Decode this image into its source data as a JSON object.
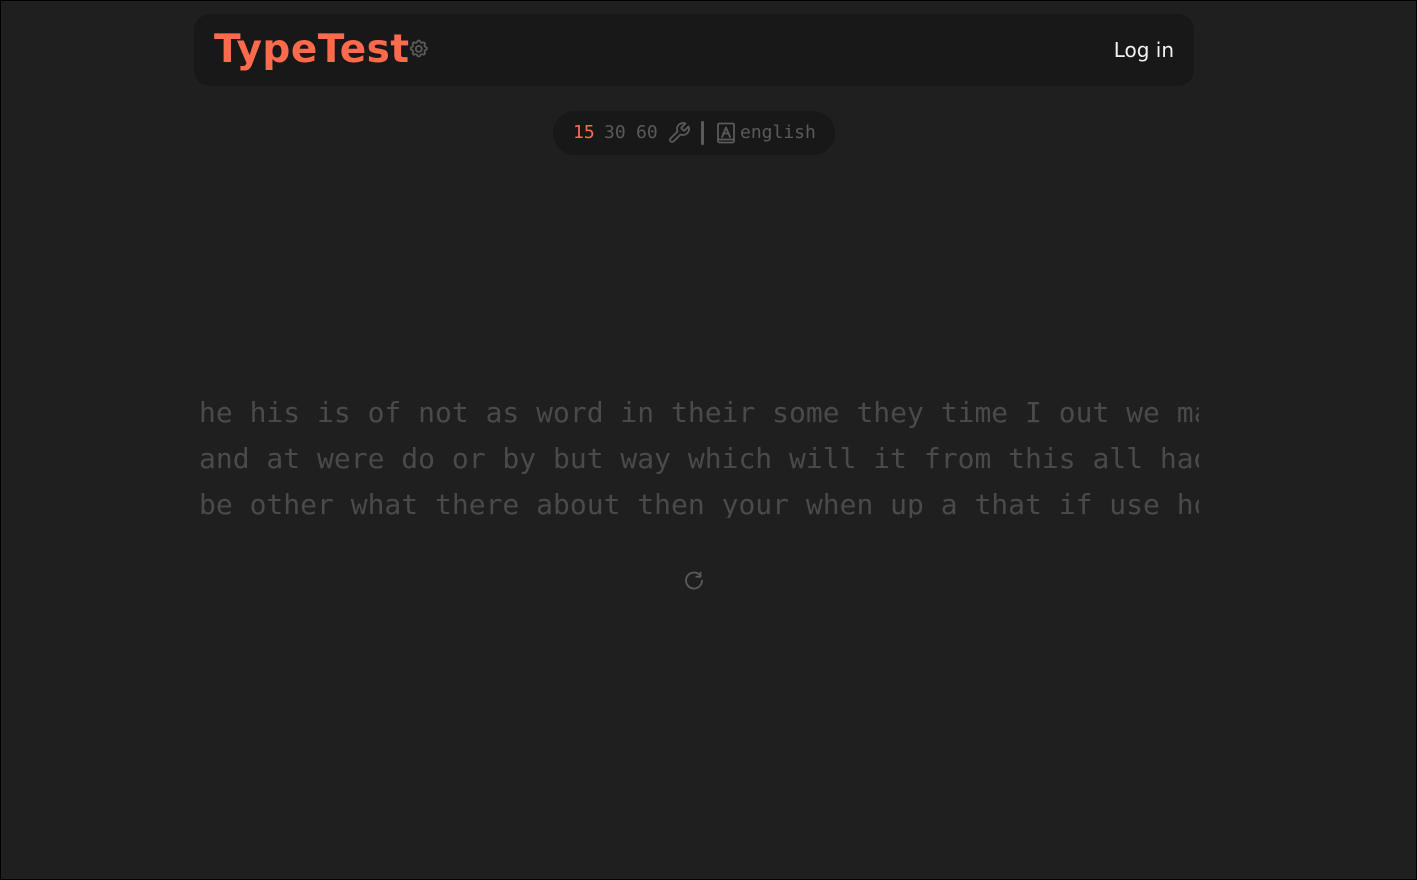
{
  "header": {
    "logo": "TypeTest",
    "settings_icon": "gear-icon",
    "login_label": "Log in"
  },
  "config": {
    "durations": [
      {
        "label": "15",
        "active": true
      },
      {
        "label": "30",
        "active": false
      },
      {
        "label": "60",
        "active": false
      }
    ],
    "custom_icon": "wrench-icon",
    "language_icon": "language-book-icon",
    "language": "english"
  },
  "test": {
    "lines": [
      "he his is of not as word in their some they time I out we many the",
      "and at were do or by but way which will it from this all had to can",
      "be other what there about then your when up a that if use how she"
    ],
    "restart_icon": "restart-icon"
  },
  "colors": {
    "accent": "#ff6a4d",
    "background": "#1f1f1f",
    "panel": "#181818",
    "muted": "#5a5a5a",
    "text_untyped": "#4a4a4a",
    "text_light": "#f2f2f2"
  }
}
